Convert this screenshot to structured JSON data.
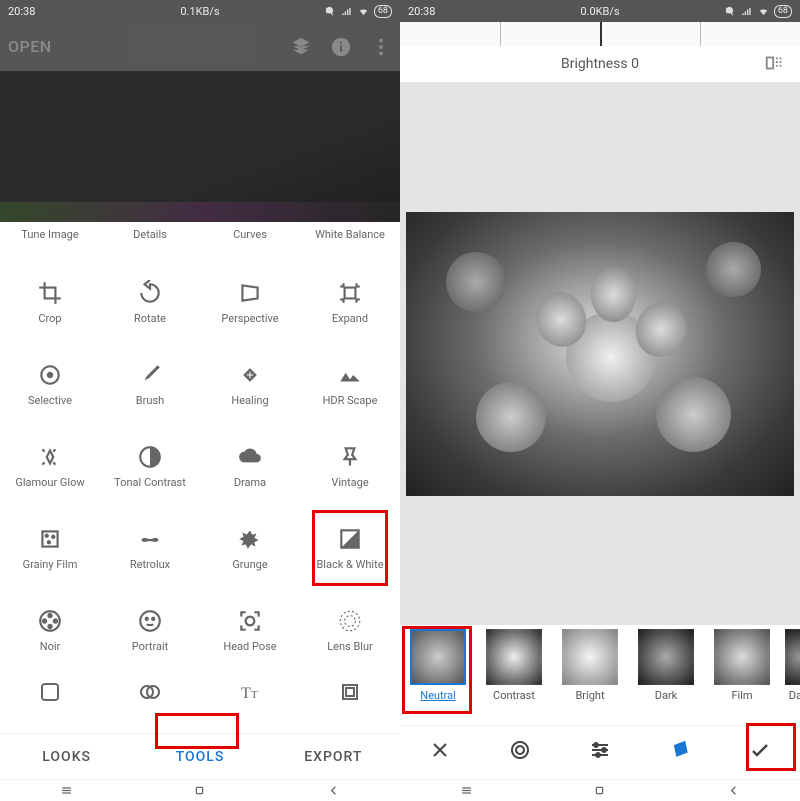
{
  "left": {
    "status": {
      "time": "20:38",
      "speed": "0.1KB/s",
      "battery": "68"
    },
    "open": "OPEN",
    "row0": [
      "Tune Image",
      "Details",
      "Curves",
      "White Balance"
    ],
    "rows": [
      [
        "Crop",
        "Rotate",
        "Perspective",
        "Expand"
      ],
      [
        "Selective",
        "Brush",
        "Healing",
        "HDR Scape"
      ],
      [
        "Glamour Glow",
        "Tonal Contrast",
        "Drama",
        "Vintage"
      ],
      [
        "Grainy Film",
        "Retrolux",
        "Grunge",
        "Black & White"
      ],
      [
        "Noir",
        "Portrait",
        "Head Pose",
        "Lens Blur"
      ]
    ],
    "tabs": {
      "looks": "LOOKS",
      "tools": "TOOLS",
      "export": "EXPORT"
    }
  },
  "right": {
    "status": {
      "time": "20:38",
      "speed": "0.0KB/s",
      "battery": "68"
    },
    "brightness": "Brightness 0",
    "presets": [
      "Neutral",
      "Contrast",
      "Bright",
      "Dark",
      "Film",
      "Dark"
    ]
  }
}
